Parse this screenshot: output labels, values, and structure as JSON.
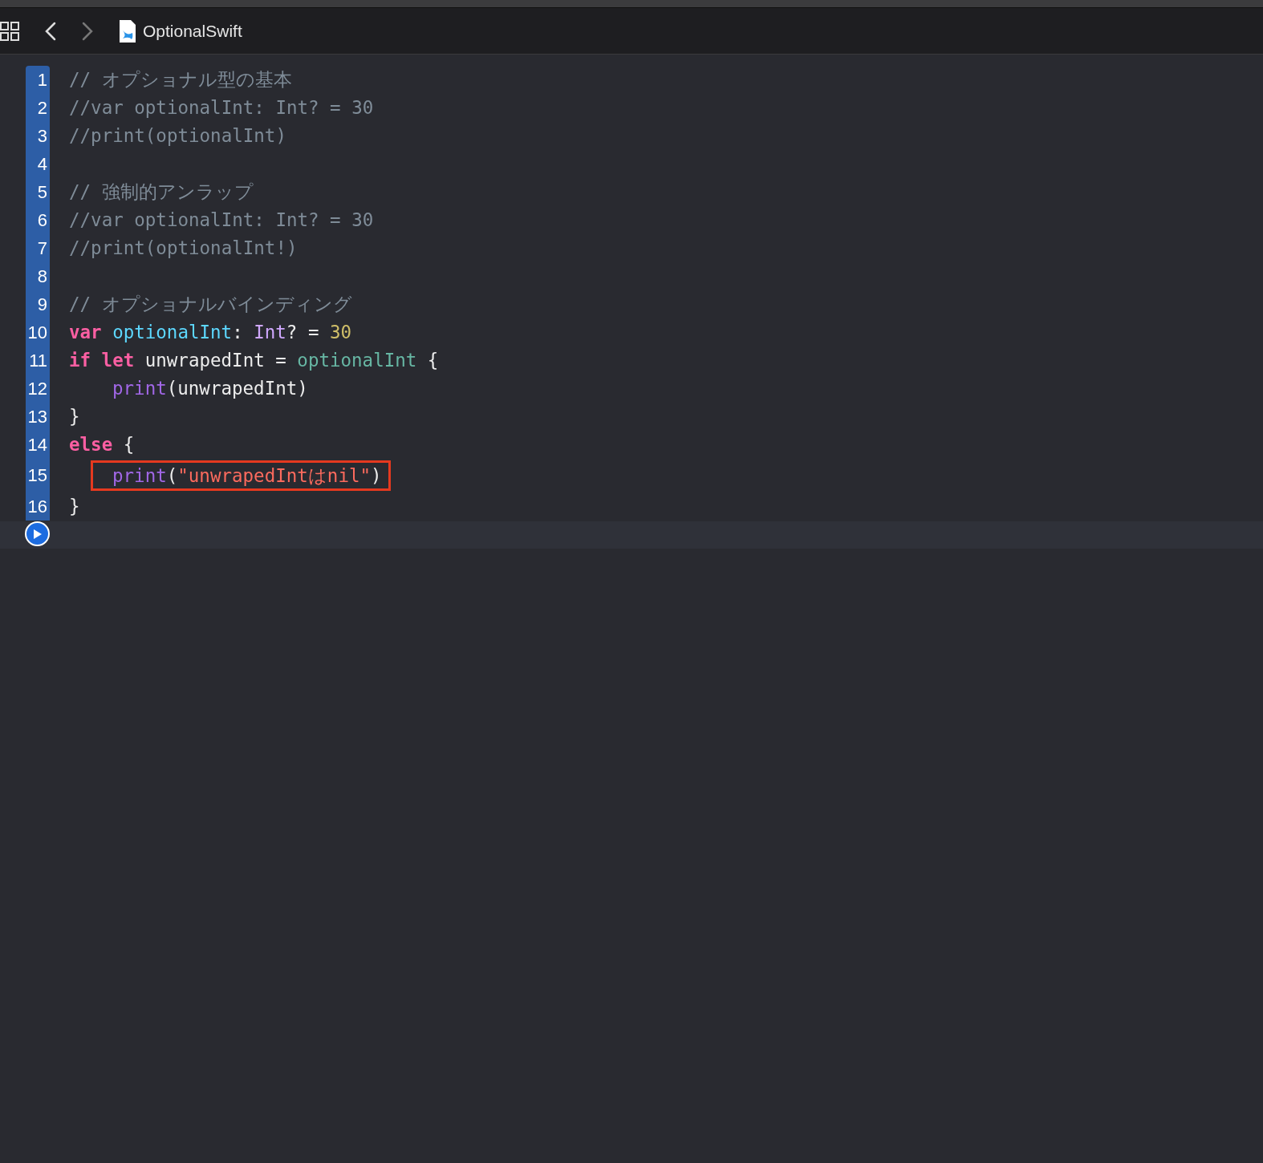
{
  "toolbar": {
    "file_name": "OptionalSwift"
  },
  "editor": {
    "lines": [
      {
        "number": "1",
        "indented": false,
        "highlighted": false,
        "tokens": [
          {
            "kind": "comment",
            "joined": false,
            "text": "// オプショナル型の基本"
          }
        ]
      },
      {
        "number": "2",
        "indented": false,
        "highlighted": false,
        "tokens": [
          {
            "kind": "comment",
            "joined": false,
            "text": "//var optionalInt: Int? = 30"
          }
        ]
      },
      {
        "number": "3",
        "indented": false,
        "highlighted": false,
        "tokens": [
          {
            "kind": "comment",
            "joined": false,
            "text": "//print(optionalInt)"
          }
        ]
      },
      {
        "number": "4",
        "highlighted": false
      },
      {
        "number": "5",
        "indented": false,
        "highlighted": false,
        "tokens": [
          {
            "kind": "comment",
            "joined": false,
            "text": "// 強制的アンラップ"
          }
        ]
      },
      {
        "number": "6",
        "indented": false,
        "highlighted": false,
        "tokens": [
          {
            "kind": "comment",
            "joined": false,
            "text": "//var optionalInt: Int? = 30"
          }
        ]
      },
      {
        "number": "7",
        "indented": false,
        "highlighted": false,
        "tokens": [
          {
            "kind": "comment",
            "joined": false,
            "text": "//print(optionalInt!)"
          }
        ]
      },
      {
        "number": "8",
        "highlighted": false
      },
      {
        "number": "9",
        "indented": false,
        "highlighted": false,
        "tokens": [
          {
            "kind": "comment",
            "joined": false,
            "text": "// オプショナルバインディング"
          }
        ]
      },
      {
        "number": "10",
        "indented": false,
        "highlighted": false,
        "tokens": [
          {
            "kind": "keyword",
            "joined": false,
            "text": "var"
          },
          {
            "kind": "declaration",
            "joined": false,
            "text": "optionalInt"
          },
          {
            "kind": "plain",
            "joined": true,
            "text": ":"
          },
          {
            "kind": "type",
            "joined": false,
            "text": "Int"
          },
          {
            "kind": "plain",
            "joined": true,
            "text": "? ="
          },
          {
            "kind": "number",
            "joined": false,
            "text": "30"
          }
        ]
      },
      {
        "number": "11",
        "indented": false,
        "highlighted": false,
        "tokens": [
          {
            "kind": "keyword",
            "joined": false,
            "text": "if"
          },
          {
            "kind": "keyword",
            "joined": false,
            "text": "let"
          },
          {
            "kind": "plain",
            "joined": false,
            "text": "unwrapedInt ="
          },
          {
            "kind": "reference",
            "joined": false,
            "text": "optionalInt"
          },
          {
            "kind": "plain",
            "joined": false,
            "text": "{"
          }
        ]
      },
      {
        "number": "12",
        "indented": true,
        "highlighted": false,
        "tokens": [
          {
            "kind": "function",
            "joined": false,
            "text": "print"
          },
          {
            "kind": "plain",
            "joined": true,
            "text": "(unwrapedInt)"
          }
        ]
      },
      {
        "number": "13",
        "indented": false,
        "highlighted": false,
        "tokens": [
          {
            "kind": "plain",
            "joined": false,
            "text": "}"
          }
        ]
      },
      {
        "number": "14",
        "indented": false,
        "highlighted": false,
        "tokens": [
          {
            "kind": "keyword",
            "joined": false,
            "text": "else"
          },
          {
            "kind": "plain",
            "joined": false,
            "text": "{"
          }
        ]
      },
      {
        "number": "15",
        "indented": true,
        "highlighted": true,
        "tokens": [
          {
            "kind": "function",
            "joined": false,
            "text": "print"
          },
          {
            "kind": "plain",
            "joined": true,
            "text": "("
          },
          {
            "kind": "string",
            "joined": true,
            "text": "\"unwrapedIntはnil\""
          },
          {
            "kind": "plain",
            "joined": true,
            "text": ")"
          }
        ]
      },
      {
        "number": "16",
        "indented": false,
        "highlighted": false,
        "tokens": [
          {
            "kind": "plain",
            "joined": false,
            "text": "}"
          }
        ]
      }
    ]
  }
}
